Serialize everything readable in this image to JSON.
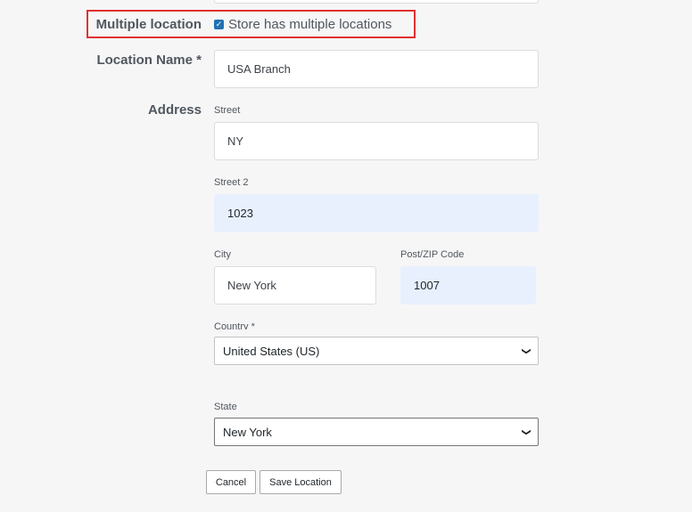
{
  "multiple_location": {
    "label": "Multiple location",
    "checkbox_label": "Store has multiple locations",
    "checked": true
  },
  "location_name": {
    "label": "Location Name *",
    "value": "USA Branch"
  },
  "address": {
    "label": "Address",
    "street": {
      "label": "Street",
      "value": "NY"
    },
    "street2": {
      "label": "Street 2",
      "value": "1023"
    },
    "city": {
      "label": "City",
      "value": "New York"
    },
    "zip": {
      "label": "Post/ZIP Code",
      "value": "1007"
    },
    "country": {
      "label": "Country *",
      "value": "United States (US)"
    },
    "state": {
      "label": "State",
      "value": "New York"
    }
  },
  "buttons": {
    "cancel": "Cancel",
    "save": "Save Location"
  },
  "colors": {
    "highlight_border": "#e03131",
    "autofill_bg": "#e8f0fe",
    "checkbox": "#2271b1"
  }
}
